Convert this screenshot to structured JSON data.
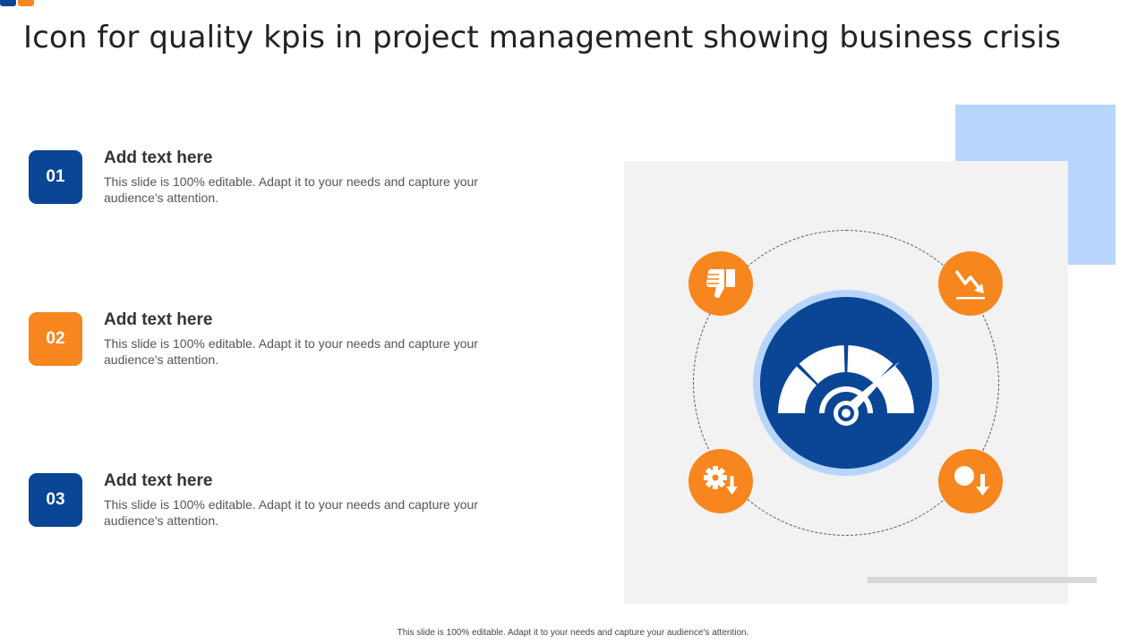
{
  "slide": {
    "title": "Icon for quality kpis in project management showing business crisis",
    "footer": "This slide is 100% editable. Adapt it to your needs and capture your audience's attention."
  },
  "items": [
    {
      "number": "01",
      "heading": "Add text here",
      "body": "This slide is 100% editable. Adapt it to your needs and capture your audience's attention.",
      "color": "#0a4596"
    },
    {
      "number": "02",
      "heading": "Add text here",
      "body": "This slide is 100% editable. Adapt it to your needs and capture your audience's attention.",
      "color": "#f7861e"
    },
    {
      "number": "03",
      "heading": "Add text here",
      "body": "This slide is 100% editable. Adapt it to your needs and capture your audience's attention.",
      "color": "#0a4596"
    }
  ],
  "graphic": {
    "center_icon": "speedometer-icon",
    "satellite_icons": [
      "thumbs-down-icon",
      "trend-down-icon",
      "gear-down-icon",
      "search-down-icon"
    ]
  },
  "colors": {
    "primary_blue": "#0a4596",
    "accent_orange": "#f7861e",
    "light_blue": "#b7d5fb",
    "panel_gray": "#f2f2f2"
  }
}
